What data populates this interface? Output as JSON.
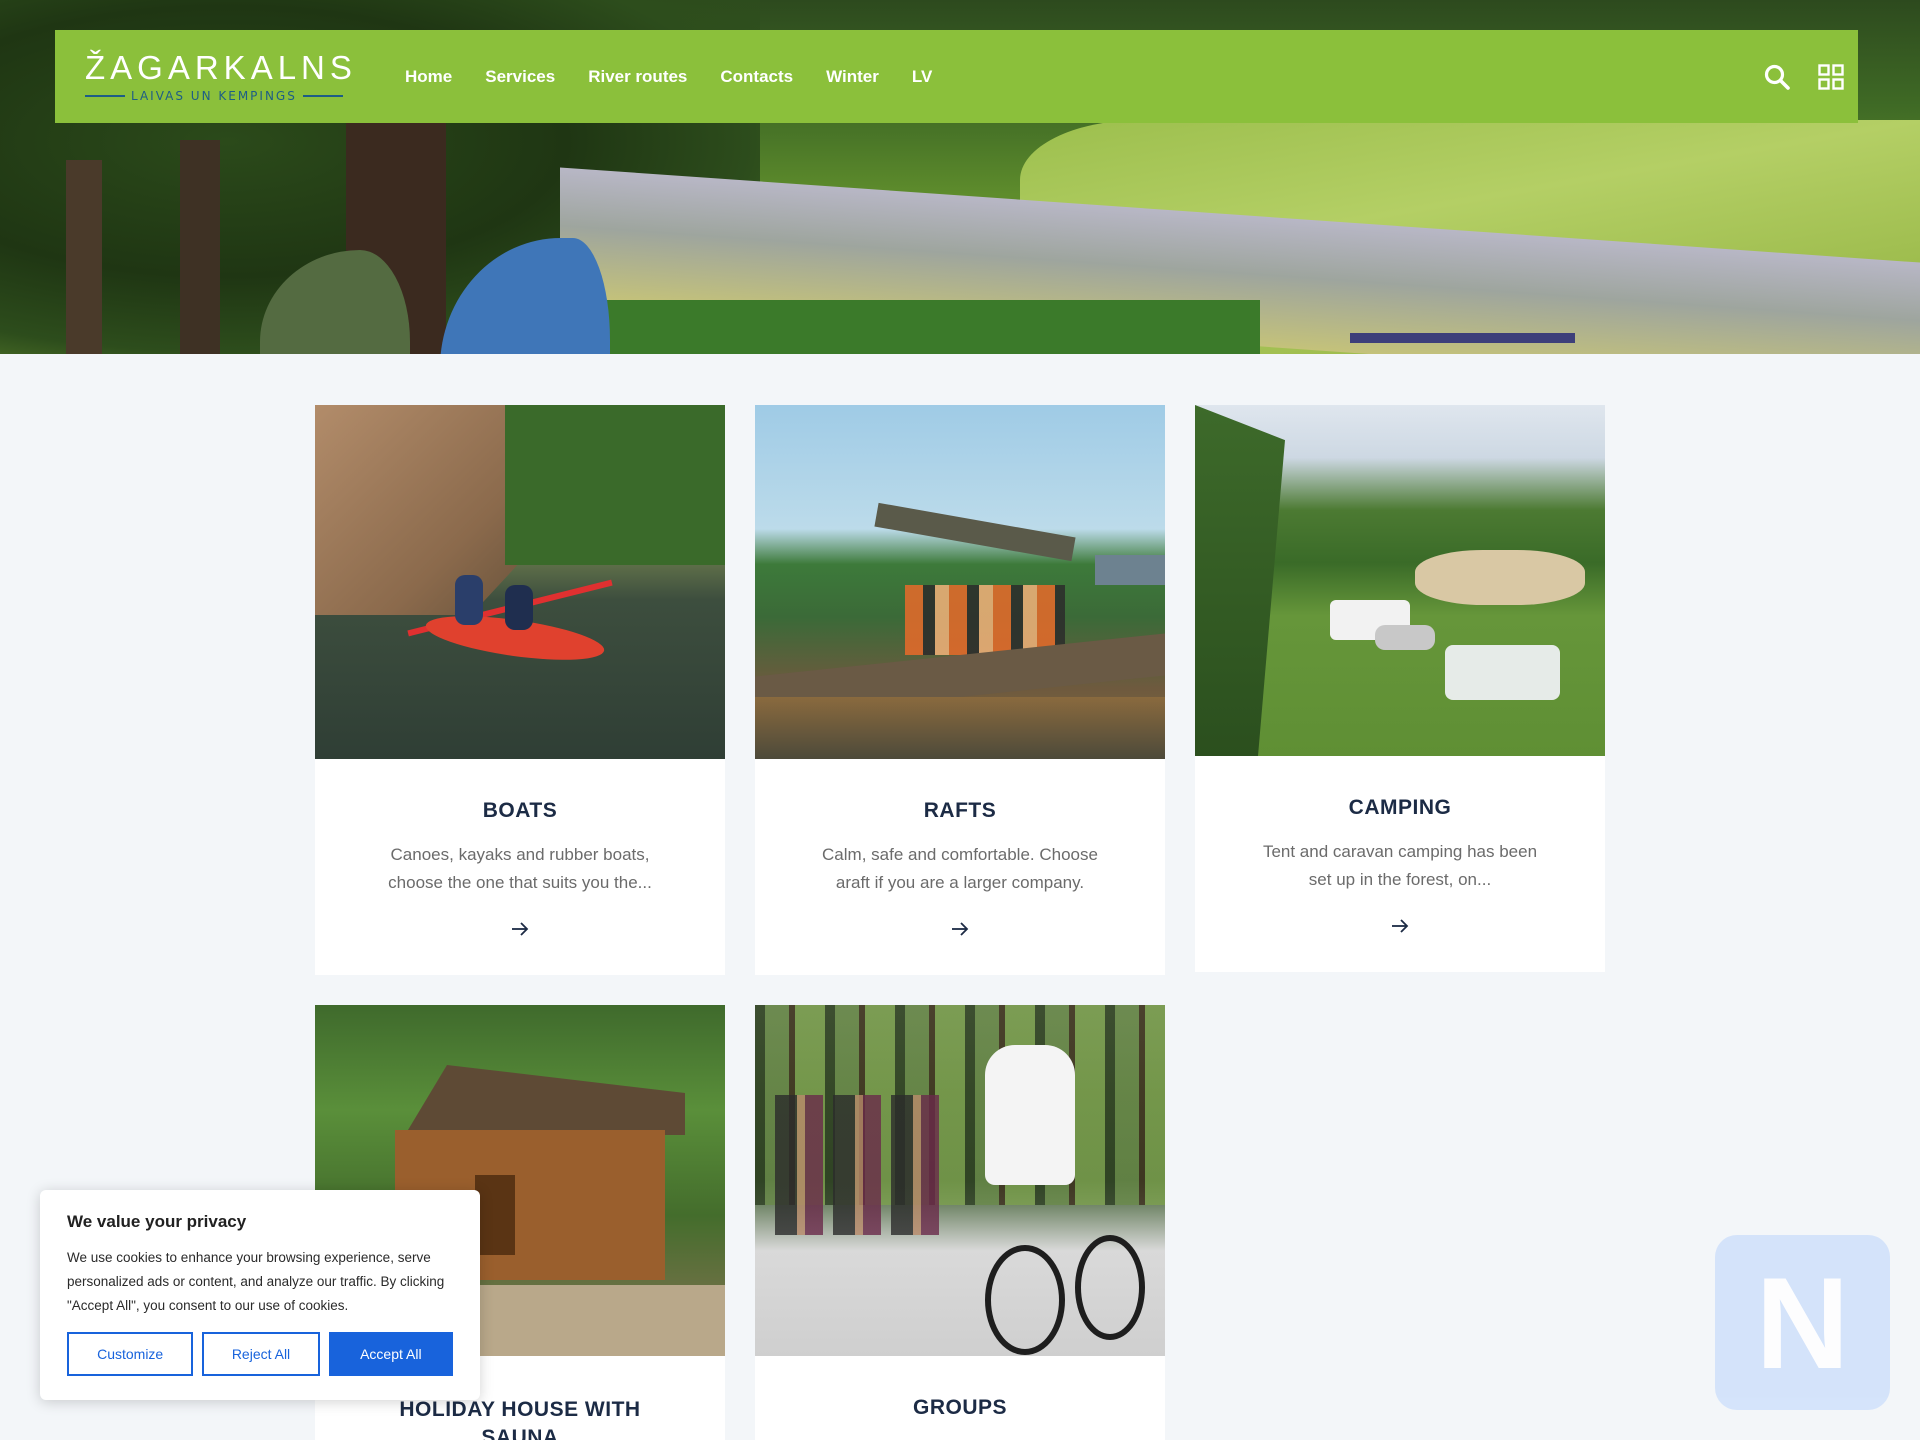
{
  "brand": {
    "name": "ŽAGARKALNS",
    "tagline": "LAIVAS UN KEMPINGS"
  },
  "nav": {
    "items": [
      {
        "label": "Home"
      },
      {
        "label": "Services"
      },
      {
        "label": "River routes"
      },
      {
        "label": "Contacts"
      },
      {
        "label": "Winter"
      },
      {
        "label": "LV"
      }
    ],
    "icons": [
      "search-icon",
      "grid-menu-icon"
    ]
  },
  "cards": [
    {
      "title": "BOATS",
      "description": "Canoes, kayaks and rubber boats, choose the one that suits you the...",
      "icon": "arrow-right-icon"
    },
    {
      "title": "RAFTS",
      "description": "Calm, safe and comfortable. Choose araft if you are a larger company.",
      "icon": "arrow-right-icon"
    },
    {
      "title": "CAMPING",
      "description": "Tent and caravan camping has been set up in the forest, on...",
      "icon": "arrow-right-icon"
    },
    {
      "title": "HOLIDAY HOUSE WITH SAUNA"
    },
    {
      "title": "GROUPS"
    }
  ],
  "cookie": {
    "title": "We value your privacy",
    "text": "We use cookies to enhance your browsing experience, serve personalized ads or content, and analyze our traffic. By clicking \"Accept All\", you consent to our use of cookies.",
    "customize": "Customize",
    "reject": "Reject All",
    "accept": "Accept All"
  },
  "badge": {
    "letter": "N"
  },
  "colors": {
    "nav_green": "#8bc03b",
    "accent_blue": "#1863dc",
    "heading_navy": "#1c2b45",
    "page_bg": "#f3f6f9"
  }
}
